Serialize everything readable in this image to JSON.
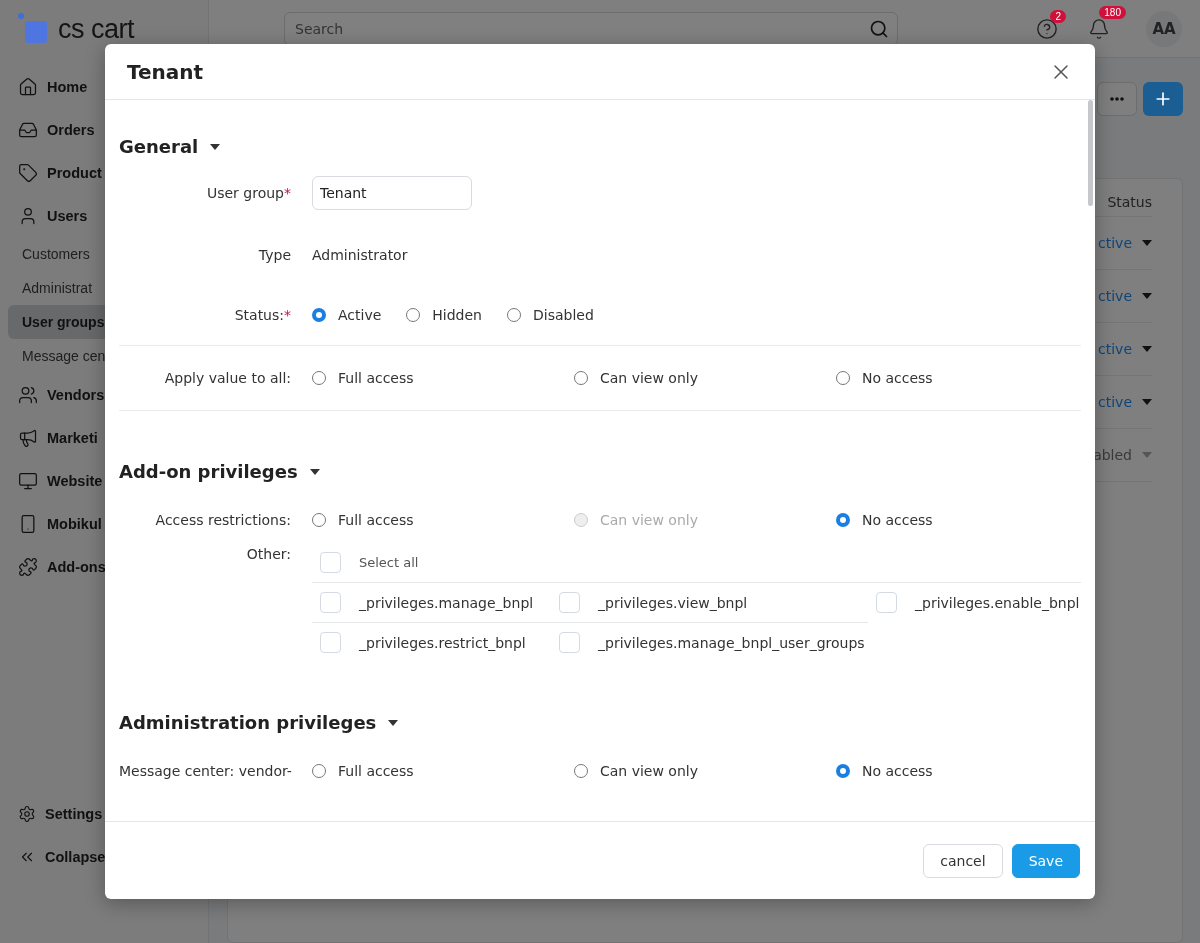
{
  "app": {
    "logo": "cs cart",
    "search": {
      "placeholder": "Search"
    },
    "help_badge": "2",
    "notifications_badge": "180",
    "avatar": "AA"
  },
  "sidebar": {
    "items": [
      {
        "label": "Home",
        "kind": "main",
        "selected": false
      },
      {
        "label": "Orders",
        "kind": "main",
        "selected": false
      },
      {
        "label": "Product",
        "kind": "main",
        "selected": false
      },
      {
        "label": "Users",
        "kind": "main",
        "selected": false
      },
      {
        "label": "Customers",
        "kind": "sub",
        "selected": false
      },
      {
        "label": "Administrat",
        "kind": "sub",
        "selected": false
      },
      {
        "label": "User groups",
        "kind": "sub",
        "selected": true
      },
      {
        "label": "Message cen",
        "kind": "sub",
        "selected": false
      },
      {
        "label": "Vendors",
        "kind": "main",
        "selected": false
      },
      {
        "label": "Marketi",
        "kind": "main",
        "selected": false
      },
      {
        "label": "Website",
        "kind": "main",
        "selected": false
      },
      {
        "label": "Mobikul",
        "kind": "main",
        "selected": false
      },
      {
        "label": "Add-ons",
        "kind": "main",
        "selected": false
      }
    ],
    "footer": [
      {
        "label": "Settings"
      },
      {
        "label": "Collapse"
      }
    ]
  },
  "table": {
    "column": "Status",
    "rows": [
      {
        "status": "ctive",
        "kind": "active"
      },
      {
        "status": "ctive",
        "kind": "active"
      },
      {
        "status": "ctive",
        "kind": "active"
      },
      {
        "status": "ctive",
        "kind": "active"
      },
      {
        "status": "abled",
        "kind": "disabled"
      }
    ]
  },
  "modal": {
    "title": "Tenant",
    "sections": [
      {
        "title": "General",
        "expanded": true,
        "rows": [
          {
            "kind": "input",
            "label": "User group",
            "required_mark": "*",
            "value": "Tenant"
          },
          {
            "kind": "text",
            "label": "Type",
            "value": "Administrator"
          },
          {
            "kind": "radio",
            "label": "Status:",
            "required_mark": "*",
            "options": [
              {
                "label": "Active",
                "selected": true,
                "disabled": false
              },
              {
                "label": "Hidden",
                "selected": false,
                "disabled": false
              },
              {
                "label": "Disabled",
                "selected": false,
                "disabled": false
              }
            ]
          },
          {
            "kind": "apply",
            "label": "Apply value to all:",
            "options": [
              {
                "label": "Full access",
                "selected": false,
                "disabled": false
              },
              {
                "label": "Can view only",
                "selected": false,
                "disabled": false
              },
              {
                "label": "No access",
                "selected": false,
                "disabled": false
              }
            ]
          }
        ]
      },
      {
        "title": "Add-on privileges",
        "expanded": true,
        "rows": [
          {
            "kind": "access",
            "label": "Access restrictions:",
            "options": [
              {
                "label": "Full access",
                "selected": false,
                "disabled": false
              },
              {
                "label": "Can view only",
                "selected": false,
                "disabled": true
              },
              {
                "label": "No access",
                "selected": true,
                "disabled": false
              }
            ]
          },
          {
            "kind": "checkboxes",
            "label": "Other:",
            "select_all": {
              "label": "Select all",
              "checked": false
            },
            "options": [
              {
                "label": "_privileges.manage_bnpl",
                "checked": false
              },
              {
                "label": "_privileges.view_bnpl",
                "checked": false
              },
              {
                "label": "_privileges.enable_bnpl",
                "checked": false
              },
              {
                "label": "_privileges.restrict_bnpl",
                "checked": false
              },
              {
                "label": "_privileges.manage_bnpl_user_groups",
                "checked": false
              }
            ]
          }
        ]
      },
      {
        "title": "Administration privileges",
        "expanded": true,
        "rows": [
          {
            "kind": "access",
            "label": "Message center: vendor-",
            "options": [
              {
                "label": "Full access",
                "selected": false,
                "disabled": false
              },
              {
                "label": "Can view only",
                "selected": false,
                "disabled": false
              },
              {
                "label": "No access",
                "selected": true,
                "disabled": false
              }
            ]
          }
        ]
      }
    ],
    "buttons": [
      {
        "label": "cancel",
        "kind": "secondary"
      },
      {
        "label": "Save",
        "kind": "primary"
      }
    ]
  }
}
